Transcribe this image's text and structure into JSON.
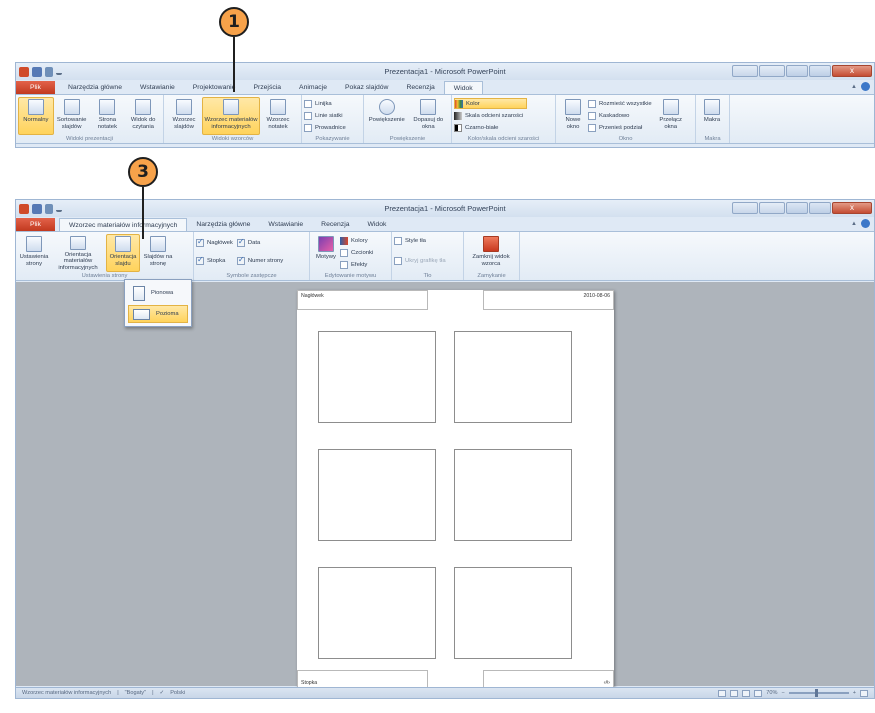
{
  "callouts": {
    "one": "1",
    "three": "3"
  },
  "window1": {
    "title": "Prezentacja1 - Microsoft PowerPoint",
    "tabs": [
      "Plik",
      "Narzędzia główne",
      "Wstawianie",
      "Projektowanie",
      "Przejścia",
      "Animacje",
      "Pokaz slajdów",
      "Recenzja",
      "Widok"
    ],
    "groups": {
      "prezentacji": "Widoki prezentacji",
      "wzorcow": "Widoki wzorców",
      "pokazywanie": "Pokazywanie",
      "powiekszenie": "Powiększenie",
      "kolor": "Kolor/skala odcieni szarości",
      "okno": "Okno",
      "makra": "Makra"
    },
    "buttons": {
      "normalny": "Normalny",
      "sortowanie": "Sortowanie slajdów",
      "strona_notatek": "Strona notatek",
      "widok_czytania": "Widok do czytania",
      "wzorzec_slajdow": "Wzorzec slajdów",
      "wzorzec_materialow": "Wzorzec materiałów informacyjnych",
      "wzorzec_notatek": "Wzorzec notatek",
      "linijka": "Linijka",
      "linie_siatki": "Linie siatki",
      "prowadnice": "Prowadnice",
      "powiekszenie": "Powiększenie",
      "dopasuj": "Dopasuj do okna",
      "kolor": "Kolor",
      "skala": "Skala odcieni szarości",
      "czarno_biale": "Czarno-białe",
      "nowe_okno": "Nowe okno",
      "rozmiesc": "Rozmieść wszystkie",
      "kaskadowo": "Kaskadowo",
      "przenies": "Przenieś podział",
      "przelacz": "Przełącz okna",
      "makra": "Makra"
    }
  },
  "window2": {
    "title": "Prezentacja1 - Microsoft PowerPoint",
    "tabs": [
      "Plik",
      "Wzorzec materiałów informacyjnych",
      "Narzędzia główne",
      "Wstawianie",
      "Recenzja",
      "Widok"
    ],
    "groups": {
      "ustawienia": "Ustawienia strony",
      "symbole": "Symbole zastępcze",
      "edytowanie": "Edytowanie motywu",
      "tlo": "Tło",
      "zamykanie": "Zamykanie"
    },
    "buttons": {
      "ustawienia_strony": "Ustawienia strony",
      "orientacja_materialow": "Orientacja materiałów informacyjnych",
      "orientacja_slajdu": "Orientacja slajdu",
      "slajdow_na_strone": "Slajdów na stronę",
      "naglowek": "Nagłówek",
      "data": "Data",
      "stopka": "Stopka",
      "numer_strony": "Numer strony",
      "motywy": "Motywy",
      "kolory": "Kolory",
      "czcionki": "Czcionki",
      "efekty": "Efekty",
      "style_tla": "Style tła",
      "ukryj_grafike": "Ukryj grafikę tła",
      "zamknij": "Zamknij widok wzorca"
    },
    "dropdown": [
      "Pionowa",
      "Pozioma"
    ],
    "page": {
      "header": "Nagłówek",
      "date": "2010-08-06",
      "footer": "Stopka",
      "page_number": "‹#›"
    },
    "status": {
      "view": "Wzorzec materiałów informacyjnych",
      "theme": "\"Bogaty\"",
      "language": "Polski",
      "zoom": "70%"
    }
  }
}
